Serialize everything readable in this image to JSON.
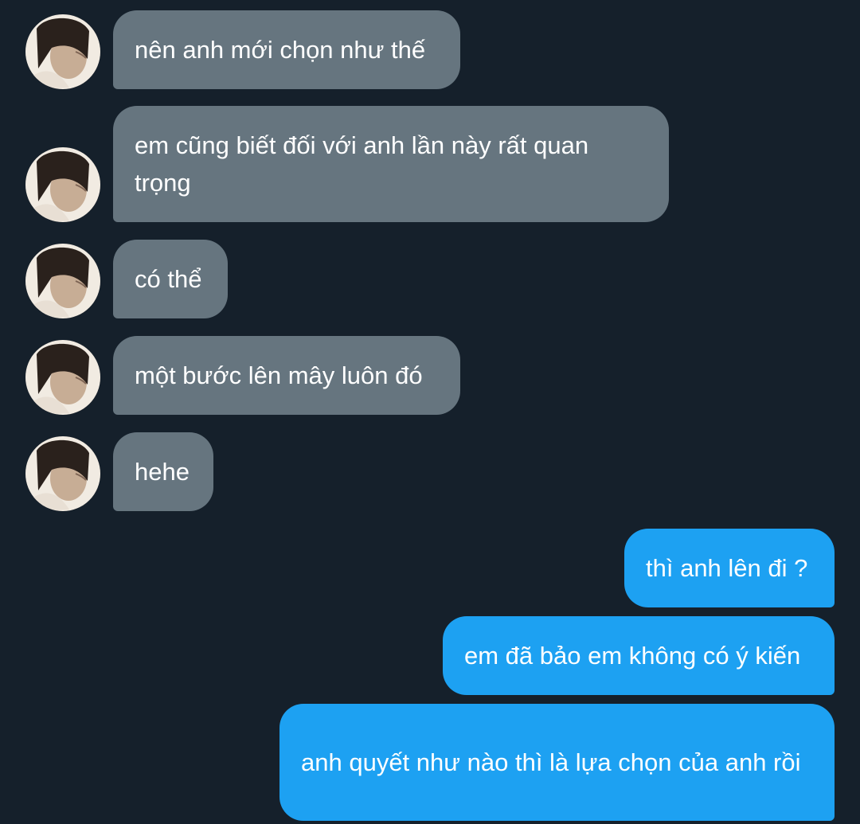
{
  "messages": [
    {
      "direction": "in",
      "text": "nên anh mới chọn như thế"
    },
    {
      "direction": "in",
      "text": "em cũng biết đối với anh lần này rất quan trọng"
    },
    {
      "direction": "in",
      "text": "có thể"
    },
    {
      "direction": "in",
      "text": "một bước lên mây luôn đó"
    },
    {
      "direction": "in",
      "text": "hehe"
    },
    {
      "direction": "out",
      "text": "thì anh lên đi ?"
    },
    {
      "direction": "out",
      "text": "em đã bảo em không có ý kiến"
    },
    {
      "direction": "out",
      "text": "anh quyết như nào thì là lựa chọn của anh rồi"
    }
  ],
  "colors": {
    "background": "#15202b",
    "incoming_bubble": "#66757f",
    "outgoing_bubble": "#1da1f2",
    "text": "#ffffff"
  },
  "avatar": {
    "icon": "profile-photo"
  }
}
